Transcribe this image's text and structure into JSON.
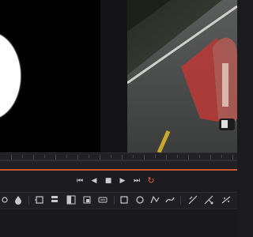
{
  "app": {
    "accent_color": "#c6562a",
    "loop_color": "#e35a3d"
  },
  "viewers": {
    "left": {
      "content": "matte-preview"
    },
    "right": {
      "content": "road-footage-with-red-mask"
    }
  },
  "transport": {
    "buttons": [
      {
        "name": "go-to-start-button",
        "icon": "skip-back-icon",
        "glyph": "⏮"
      },
      {
        "name": "play-reverse-button",
        "icon": "play-reverse-icon",
        "glyph": "◀"
      },
      {
        "name": "stop-button",
        "icon": "stop-icon",
        "glyph": "■"
      },
      {
        "name": "play-button",
        "icon": "play-icon",
        "glyph": "▶"
      },
      {
        "name": "go-to-end-button",
        "icon": "skip-forward-icon",
        "glyph": "⏭"
      },
      {
        "name": "loop-button",
        "icon": "loop-icon",
        "glyph": "↻"
      }
    ]
  },
  "toolbar": {
    "tools": [
      "node-tool-icon",
      "drop-icon",
      "merge-icon",
      "layer-icon",
      "mask-icon",
      "transform-icon",
      "paint-icon",
      "rectangle-icon",
      "ellipse-icon",
      "polygon-icon",
      "bspline-icon",
      "tracker-icon",
      "warp-icon",
      "particles-icon"
    ]
  }
}
